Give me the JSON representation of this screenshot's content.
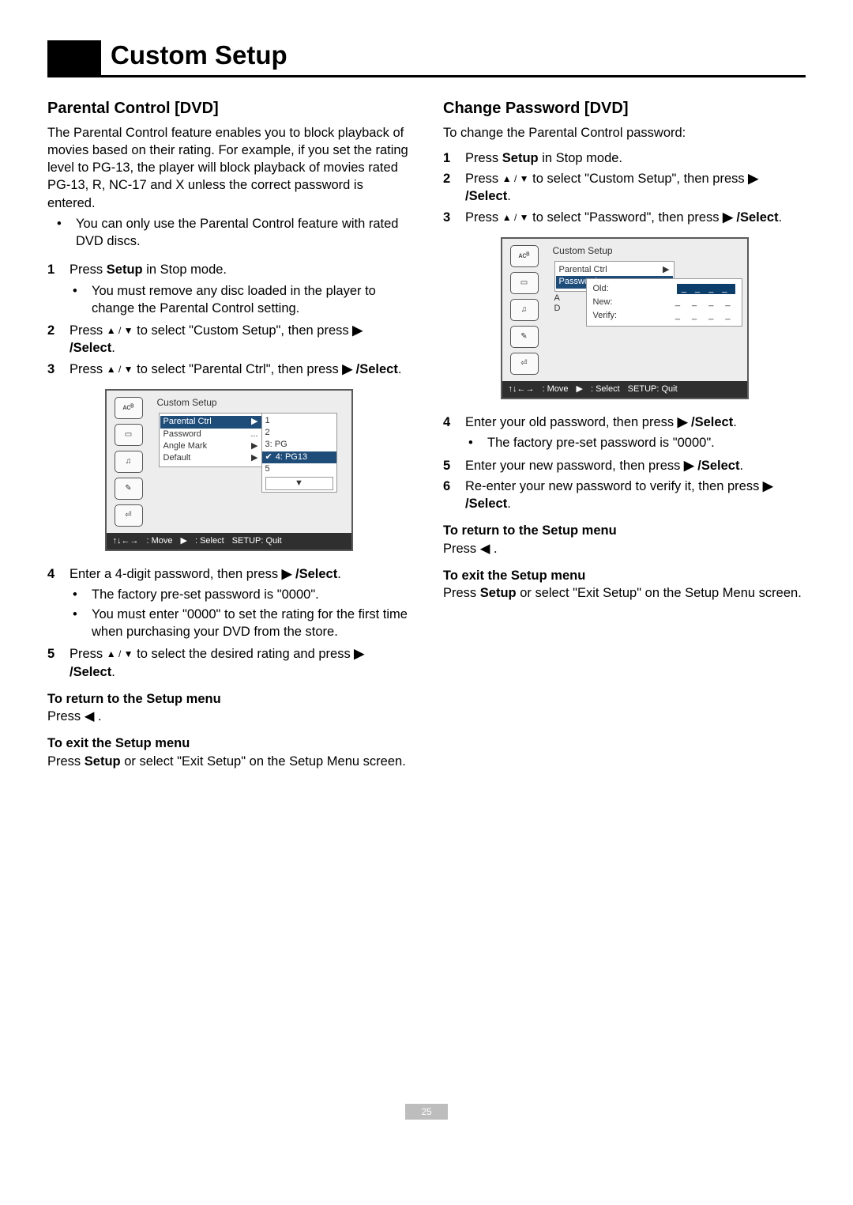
{
  "page_number": "25",
  "title": "Custom Setup",
  "left": {
    "heading": "Parental Control [DVD]",
    "intro": "The Parental Control feature enables you to block playback of movies based on their rating. For example, if you set the rating level to PG-13, the player will block playback of movies rated PG-13, R, NC-17 and X unless the correct password is entered.",
    "top_bullet": "You can only use the Parental Control feature with rated DVD discs.",
    "steps": {
      "s1_a": "Press ",
      "s1_b": "Setup",
      "s1_c": " in Stop mode.",
      "s1_sub": "You must remove any disc loaded in the player to change the Parental Control setting.",
      "s2_a": "Press ",
      "s2_arrow": "▲ / ▼",
      "s2_b": " to select \"Custom Setup\", then press ",
      "s2_c": "▶ /Select",
      "period2": ".",
      "s3_a": "Press ",
      "s3_arrow": "▲ / ▼",
      "s3_b": " to select \"Parental Ctrl\", then press ",
      "s3_c": "▶ /Select",
      "period3": ".",
      "s4_a": "Enter a 4-digit password, then press ",
      "s4_b": "▶ /Select",
      "period4": ".",
      "s4_sub1": "The factory pre-set password is \"0000\".",
      "s4_sub2": "You must enter \"0000\" to set the rating for the first time when purchasing your DVD from the store.",
      "s5_a": "Press ",
      "s5_arrow": "▲ / ▼",
      "s5_b": " to select the desired rating and press ",
      "s5_c": "▶ /Select",
      "period5": "."
    },
    "return_head": "To return to the Setup menu",
    "return_body_a": "Press ",
    "return_body_b": "◀",
    "return_body_c": " .",
    "exit_head": "To exit the Setup menu",
    "exit_body_a": "Press ",
    "exit_body_b": "Setup",
    "exit_body_c": " or select \"Exit Setup\" on the Setup Menu screen.",
    "osd": {
      "title": "Custom Setup",
      "menu": [
        "Parental Ctrl",
        "Password",
        "Angle Mark",
        "Default"
      ],
      "menu_vals": [
        "▶",
        "...",
        "▶",
        "▶"
      ],
      "sub": [
        "1",
        "2",
        "3: PG",
        "4: PG13",
        "5"
      ],
      "sub_sel": 3,
      "sub_arrow": "▼",
      "footer_move": ": Move",
      "footer_select": ": Select",
      "footer_quit": "SETUP: Quit"
    }
  },
  "right": {
    "heading": "Change Password [DVD]",
    "intro": "To change the Parental Control password:",
    "steps": {
      "s1_a": "Press ",
      "s1_b": "Setup",
      "s1_c": " in Stop mode.",
      "s2_a": "Press ",
      "s2_arrow": "▲ / ▼",
      "s2_b": " to select \"Custom Setup\", then press ",
      "s2_c": "▶ /Select",
      "period2": ".",
      "s3_a": "Press ",
      "s3_arrow": "▲ / ▼",
      "s3_b": " to select \"Password\", then press ",
      "s3_c": "▶ /Select",
      "period3": ".",
      "s4_a": "Enter your old password, then press ",
      "s4_b": "▶ /Select",
      "period4": ".",
      "s4_sub": "The factory pre-set password is \"0000\".",
      "s5_a": "Enter your new password, then press ",
      "s5_b": "▶ /Select",
      "period5": ".",
      "s6_a": "Re-enter your new password to verify it, then press ",
      "s6_b": "▶ /Select",
      "period6": "."
    },
    "return_head": "To return to the Setup menu",
    "return_body_a": "Press ",
    "return_body_b": "◀",
    "return_body_c": " .",
    "exit_head": "To exit the Setup menu",
    "exit_body_a": "Press ",
    "exit_body_b": "Setup",
    "exit_body_c": " or select \"Exit Setup\" on the Setup Menu screen.",
    "osd": {
      "title": "Custom Setup",
      "menu": [
        "Parental Ctrl",
        "Password"
      ],
      "menu_vals": [
        "▶",
        "..."
      ],
      "side_letters": [
        "A",
        "D"
      ],
      "popup": {
        "old_label": "Old:",
        "old_val": "_ _ _ _",
        "new_label": "New:",
        "new_val": "_ _ _ _",
        "verify_label": "Verify:",
        "verify_val": "_ _ _ _"
      },
      "footer_move": ": Move",
      "footer_select": ": Select",
      "footer_quit": "SETUP: Quit"
    }
  }
}
